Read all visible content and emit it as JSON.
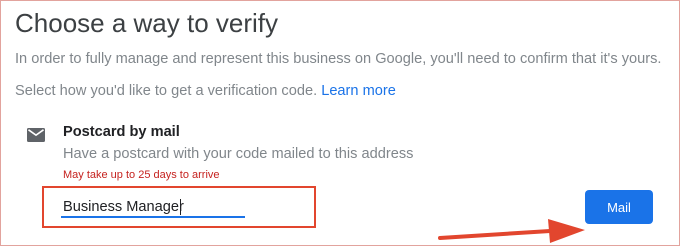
{
  "page": {
    "title": "Choose a way to verify",
    "intro": "In order to fully manage and represent this business on Google, you'll need to confirm that it's yours.",
    "select_prompt": "Select how you'd like to get a verification code.",
    "learn_more": "Learn more"
  },
  "option": {
    "icon": "mail-icon",
    "title": "Postcard by mail",
    "description": "Have a postcard with your code mailed to this address",
    "warning": "May take up to 25 days to arrive"
  },
  "form": {
    "name_value": "Business Manager",
    "mail_button": "Mail"
  },
  "colors": {
    "accent": "#1a73e8",
    "warning": "#c5221f",
    "annotation": "#e2462e"
  }
}
